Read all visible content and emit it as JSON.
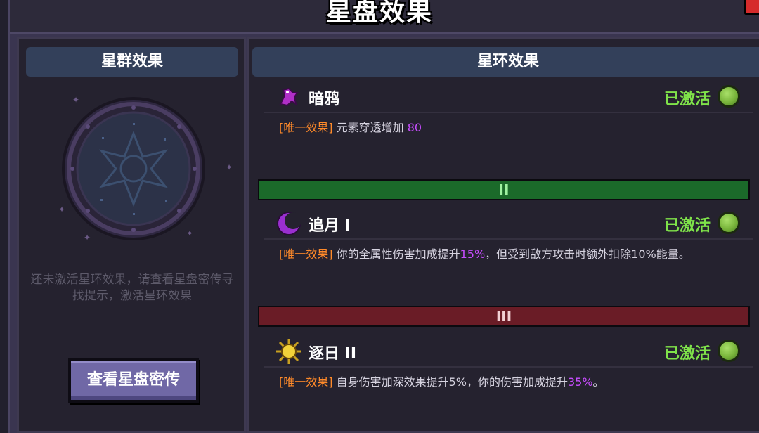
{
  "title": "星盘效果",
  "left_panel": {
    "header": "星群效果",
    "hint": "还未激活星环效果，请查看星盘密传寻找提示，激活星环效果",
    "button_label": "查看星盘密传"
  },
  "right_panel": {
    "header": "星环效果",
    "effects": [
      {
        "name": "暗鸦",
        "icon": "raven-icon",
        "status": "已激活",
        "tag": "[唯一效果]",
        "desc_prefix": "元素穿透增加",
        "desc_value": "80",
        "desc_suffix": ""
      },
      {
        "tier": "II",
        "name": "追月 I",
        "icon": "crescent-moon-icon",
        "status": "已激活",
        "tag": "[唯一效果]",
        "desc_prefix": "你的全属性伤害加成提升",
        "desc_value": "15%",
        "desc_suffix": "，但受到敌方攻击时额外扣除10%能量。"
      },
      {
        "tier": "III",
        "name": "逐日 II",
        "icon": "sun-icon",
        "status": "已激活",
        "tag": "[唯一效果]",
        "desc_prefix": "自身伤害加深效果提升5%，你的伤害加成提升",
        "desc_value": "35%",
        "desc_suffix": "。"
      }
    ]
  },
  "colors": {
    "active_green": "#7fe24a",
    "tag_orange": "#ff8a2a",
    "highlight_purple": "#c84dff",
    "tier2_bar": "#1b6a2a",
    "tier3_bar": "#6a1c26"
  }
}
